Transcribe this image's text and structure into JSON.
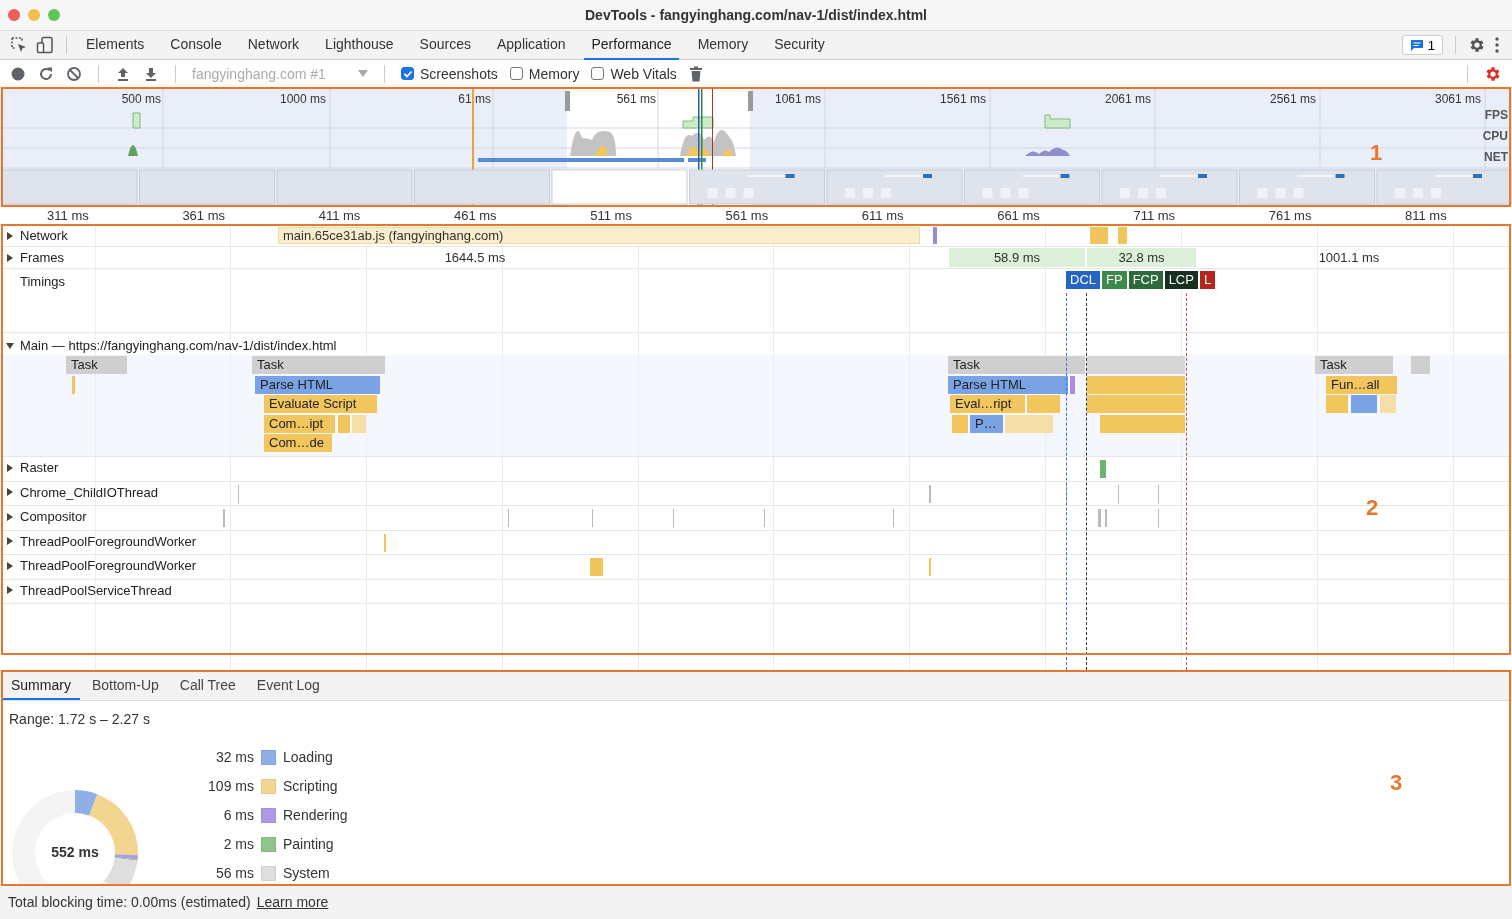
{
  "window": {
    "title": "DevTools - fangyinghang.com/nav-1/dist/index.html"
  },
  "panel_tabs": [
    {
      "label": "Elements",
      "selected": false
    },
    {
      "label": "Console",
      "selected": false
    },
    {
      "label": "Network",
      "selected": false
    },
    {
      "label": "Lighthouse",
      "selected": false
    },
    {
      "label": "Sources",
      "selected": false
    },
    {
      "label": "Application",
      "selected": false
    },
    {
      "label": "Performance",
      "selected": true
    },
    {
      "label": "Memory",
      "selected": false
    },
    {
      "label": "Security",
      "selected": false
    }
  ],
  "issues_count": "1",
  "toolbar": {
    "target": "fangyinghang.com #1",
    "options": [
      {
        "label": "Screenshots",
        "checked": true
      },
      {
        "label": "Memory",
        "checked": false
      },
      {
        "label": "Web Vitals",
        "checked": false
      }
    ]
  },
  "overview": {
    "ticks": [
      "500 ms",
      "1000 ms",
      "61 ms",
      "561 ms",
      "1061 ms",
      "1561 ms",
      "2061 ms",
      "2561 ms",
      "3061 ms"
    ],
    "lanes": [
      "FPS",
      "CPU",
      "NET"
    ]
  },
  "ruler": [
    "311 ms",
    "361 ms",
    "411 ms",
    "461 ms",
    "511 ms",
    "561 ms",
    "611 ms",
    "661 ms",
    "711 ms",
    "761 ms",
    "811 ms"
  ],
  "network": {
    "label": "Network",
    "expanded": false,
    "request": "main.65ce31ab.js (fangyinghang.com)"
  },
  "frames": {
    "label": "Frames",
    "expanded": false,
    "items": [
      {
        "label": "1644.5 ms",
        "kind": "idle"
      },
      {
        "label": "58.9 ms",
        "kind": "frame"
      },
      {
        "label": "32.8 ms",
        "kind": "frame"
      },
      {
        "label": "1001.1 ms",
        "kind": "idle"
      }
    ]
  },
  "timings": {
    "label": "Timings",
    "markers": [
      {
        "label": "DCL",
        "color": "#2563c4"
      },
      {
        "label": "FP",
        "color": "#3e8a4c"
      },
      {
        "label": "FCP",
        "color": "#2d6a3b"
      },
      {
        "label": "LCP",
        "color": "#18301f"
      },
      {
        "label": "L",
        "color": "#b3261e"
      }
    ]
  },
  "main": {
    "label": "Main — https://fangyinghang.com/nav-1/dist/index.html",
    "expanded": true,
    "events": [
      {
        "label": "Task",
        "kind": "task"
      },
      {
        "label": "Task",
        "kind": "task"
      },
      {
        "label": "Parse HTML",
        "kind": "parse"
      },
      {
        "label": "Evaluate Script",
        "kind": "script"
      },
      {
        "label": "Com…ipt",
        "kind": "script"
      },
      {
        "label": "Com…de",
        "kind": "script"
      },
      {
        "label": "Task",
        "kind": "task"
      },
      {
        "label": "Parse HTML",
        "kind": "parse"
      },
      {
        "label": "Eval…ript",
        "kind": "script"
      },
      {
        "label": "P…",
        "kind": "parse"
      },
      {
        "label": "Task",
        "kind": "task"
      },
      {
        "label": "Fun…all",
        "kind": "script"
      }
    ]
  },
  "threads": [
    {
      "label": "Raster",
      "expanded": false
    },
    {
      "label": "Chrome_ChildIOThread",
      "expanded": false
    },
    {
      "label": "Compositor",
      "expanded": false
    },
    {
      "label": "ThreadPoolForegroundWorker",
      "expanded": false
    },
    {
      "label": "ThreadPoolForegroundWorker",
      "expanded": false
    },
    {
      "label": "ThreadPoolServiceThread",
      "expanded": false
    }
  ],
  "details": {
    "tabs": [
      {
        "label": "Summary",
        "selected": true
      },
      {
        "label": "Bottom-Up",
        "selected": false
      },
      {
        "label": "Call Tree",
        "selected": false
      },
      {
        "label": "Event Log",
        "selected": false
      }
    ],
    "range": "Range: 1.72 s – 2.27 s",
    "total": "552 ms",
    "legend": [
      {
        "value": "32 ms",
        "label": "Loading",
        "color": "#8fb0e6"
      },
      {
        "value": "109 ms",
        "label": "Scripting",
        "color": "#f2d58f"
      },
      {
        "value": "6 ms",
        "label": "Rendering",
        "color": "#ae99e8"
      },
      {
        "value": "2 ms",
        "label": "Painting",
        "color": "#8fc58a"
      },
      {
        "value": "56 ms",
        "label": "System",
        "color": "#dedede"
      }
    ]
  },
  "annotations": [
    "1",
    "2",
    "3"
  ],
  "status": {
    "text": "Total blocking time: 0.00ms (estimated)",
    "link": "Learn more"
  }
}
